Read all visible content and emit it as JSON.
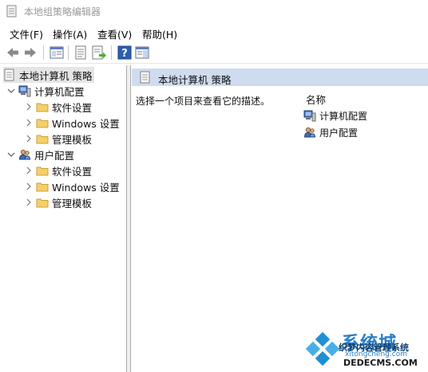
{
  "window": {
    "title": "本地组策略编辑器"
  },
  "menu": [
    {
      "label": "文件(F)"
    },
    {
      "label": "操作(A)"
    },
    {
      "label": "查看(V)"
    },
    {
      "label": "帮助(H)"
    }
  ],
  "tree": {
    "root": "本地计算机 策略",
    "computer_config": "计算机配置",
    "user_config": "用户配置",
    "software_settings": "软件设置",
    "windows_settings": "Windows 设置",
    "admin_templates": "管理模板"
  },
  "right": {
    "header": "本地计算机 策略",
    "description": "选择一个项目来查看它的描述。",
    "column_name": "名称",
    "items": [
      {
        "label": "计算机配置"
      },
      {
        "label": "用户配置"
      }
    ]
  },
  "watermark": {
    "brand": "系统城",
    "line1": "织梦内容管理系统",
    "line2": "xitongcheng.com",
    "line3": "DEDECMS.COM"
  }
}
